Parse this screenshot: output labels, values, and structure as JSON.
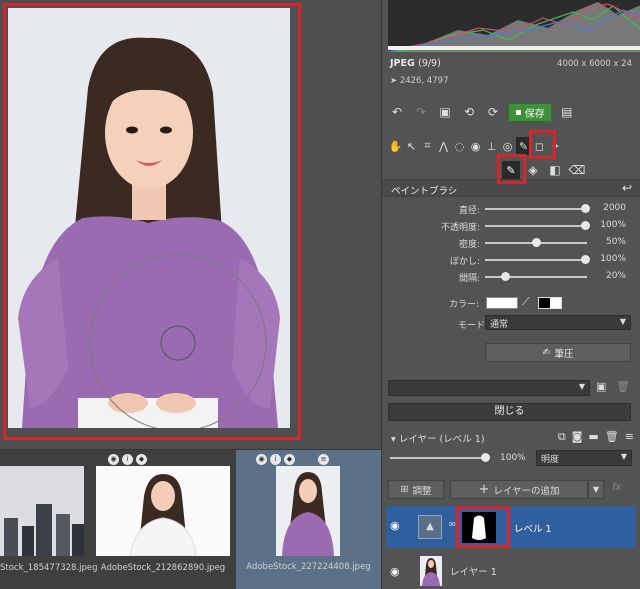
{
  "file_info": {
    "format": "JPEG",
    "count": "(9/9)",
    "dimensions": "4000 x 6000 x 24",
    "coordinates": "2426, 4797"
  },
  "toolbar": {
    "save_label": "保存"
  },
  "paint_brush": {
    "title": "ペイントブラシ",
    "sliders": [
      {
        "label": "直径:",
        "value": "2000",
        "fraction": 0.98
      },
      {
        "label": "不透明度:",
        "value": "100%",
        "fraction": 0.98
      },
      {
        "label": "密度:",
        "value": "50%",
        "fraction": 0.5
      },
      {
        "label": "ぼかし:",
        "value": "100%",
        "fraction": 0.98
      },
      {
        "label": "間隔:",
        "value": "20%",
        "fraction": 0.2
      }
    ],
    "color_label": "カラー:",
    "mode_label": "モード:",
    "mode_value": "通常",
    "pressure_label": "筆圧"
  },
  "close_label": "閉じる",
  "layers": {
    "title": "レイヤー (レベル 1)",
    "opacity": "100%",
    "opacity_fraction": 1.0,
    "blend_mode": "明度",
    "adjust_label": "調整",
    "add_layer_label": "レイヤーの追加",
    "fx_label": "fx",
    "items": [
      {
        "name": "レベル 1"
      },
      {
        "name": "レイヤー 1"
      }
    ]
  },
  "filmstrip": [
    {
      "caption": "Stock_185477328.jpeg"
    },
    {
      "caption": "AdobeStock_212862890.jpeg"
    },
    {
      "caption": "AdobeStock_227224408.jpeg"
    }
  ],
  "colors": {
    "highlight": "#d6262b",
    "save_green": "#3e8f3a",
    "selected_layer": "#2f5f9e",
    "selected_thumb": "#5a7187"
  },
  "icons": [
    "hand-icon",
    "arrow-icon",
    "crop-icon",
    "perspective-icon",
    "lasso-icon",
    "eye-icon",
    "stamp-icon",
    "brush-tool-icon",
    "shape-icon",
    "sparkle-icon",
    "paintbrush-icon",
    "bucket-icon",
    "gradient-icon",
    "eraser-icon",
    "undo-icon",
    "redo-icon",
    "image-icon",
    "rotate-left-icon",
    "rotate-right-icon",
    "disk-icon",
    "reset-icon",
    "eyedropper-icon",
    "trash-icon",
    "folder-icon",
    "mask-icon",
    "copy-icon",
    "menu-icon",
    "camera-icon",
    "info-icon",
    "tag-icon",
    "link-icon"
  ]
}
